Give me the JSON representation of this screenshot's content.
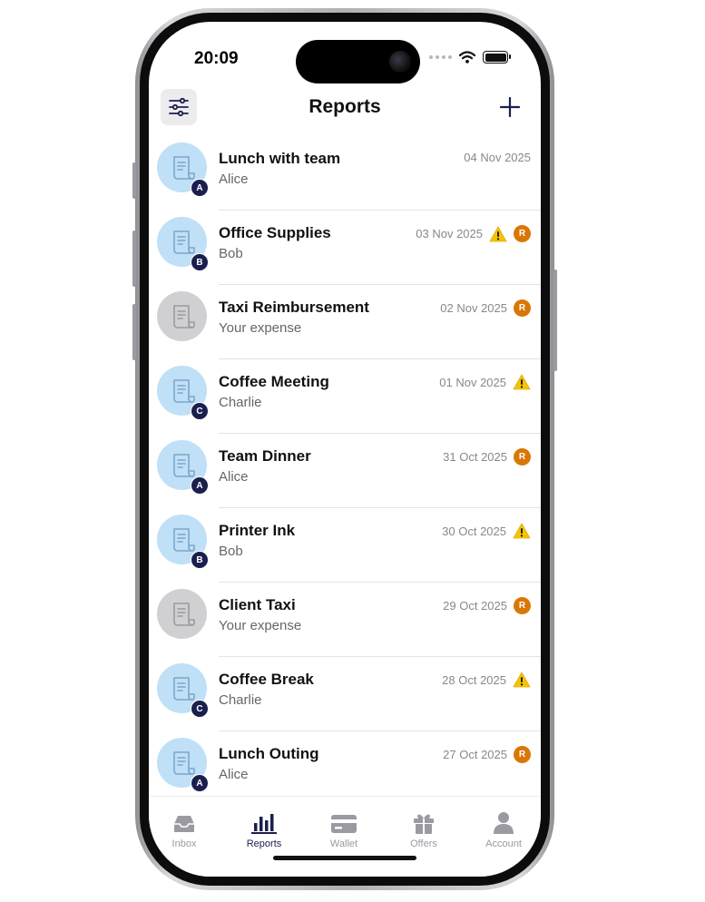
{
  "status_bar": {
    "time": "20:09"
  },
  "header": {
    "title": "Reports"
  },
  "colors": {
    "accent": "#1b1f4d",
    "avatar_blue": "#bfe0f7",
    "avatar_gray": "#d0d0d2",
    "r_badge": "#d97706",
    "warning": "#f5c400"
  },
  "reports": [
    {
      "title": "Lunch with team",
      "subtitle": "Alice",
      "date": "04 Nov 2025",
      "avatar": "blue",
      "avatar_letter": "A",
      "warning": false,
      "badge": ""
    },
    {
      "title": "Office Supplies",
      "subtitle": "Bob",
      "date": "03 Nov 2025",
      "avatar": "blue",
      "avatar_letter": "B",
      "warning": true,
      "badge": "R"
    },
    {
      "title": "Taxi Reimbursement",
      "subtitle": "Your expense",
      "date": "02 Nov 2025",
      "avatar": "gray",
      "avatar_letter": "",
      "warning": false,
      "badge": "R"
    },
    {
      "title": "Coffee Meeting",
      "subtitle": "Charlie",
      "date": "01 Nov 2025",
      "avatar": "blue",
      "avatar_letter": "C",
      "warning": true,
      "badge": ""
    },
    {
      "title": "Team Dinner",
      "subtitle": "Alice",
      "date": "31 Oct 2025",
      "avatar": "blue",
      "avatar_letter": "A",
      "warning": false,
      "badge": "R"
    },
    {
      "title": "Printer Ink",
      "subtitle": "Bob",
      "date": "30 Oct 2025",
      "avatar": "blue",
      "avatar_letter": "B",
      "warning": true,
      "badge": ""
    },
    {
      "title": "Client Taxi",
      "subtitle": "Your expense",
      "date": "29 Oct 2025",
      "avatar": "gray",
      "avatar_letter": "",
      "warning": false,
      "badge": "R"
    },
    {
      "title": "Coffee Break",
      "subtitle": "Charlie",
      "date": "28 Oct 2025",
      "avatar": "blue",
      "avatar_letter": "C",
      "warning": true,
      "badge": ""
    },
    {
      "title": "Lunch Outing",
      "subtitle": "Alice",
      "date": "27 Oct 2025",
      "avatar": "blue",
      "avatar_letter": "A",
      "warning": false,
      "badge": "R"
    }
  ],
  "tabs": [
    {
      "label": "Inbox",
      "icon": "inbox-icon",
      "active": false
    },
    {
      "label": "Reports",
      "icon": "bar-chart-icon",
      "active": true
    },
    {
      "label": "Wallet",
      "icon": "card-icon",
      "active": false
    },
    {
      "label": "Offers",
      "icon": "gift-icon",
      "active": false
    },
    {
      "label": "Account",
      "icon": "person-icon",
      "active": false
    }
  ]
}
